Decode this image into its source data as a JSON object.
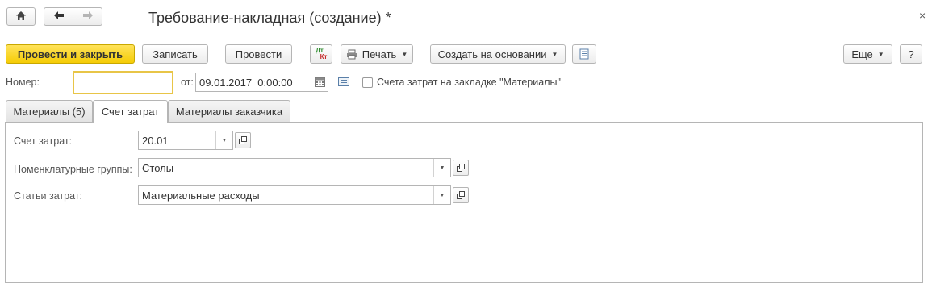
{
  "window": {
    "title": "Требование-накладная (создание) *",
    "close_glyph": "×"
  },
  "nav": {
    "home_icon": "home-icon",
    "back_icon": "arrow-left-icon",
    "forward_icon": "arrow-right-icon"
  },
  "toolbar": {
    "post_close_label": "Провести и закрыть",
    "save_label": "Записать",
    "post_label": "Провести",
    "dtkt_top": "Дт",
    "dtkt_bottom": "Кт",
    "print_label": "Печать",
    "create_based_label": "Создать на основании",
    "more_label": "Еще",
    "help_label": "?"
  },
  "header": {
    "number_label": "Номер:",
    "number_value": "",
    "date_label": "от:",
    "date_value": "09.01.2017  0:00:00",
    "checkbox_label": "Счета затрат на закладке \"Материалы\"",
    "checkbox_checked": false
  },
  "tabs": [
    {
      "label": "Материалы (5)",
      "active": false
    },
    {
      "label": "Счет затрат",
      "active": true
    },
    {
      "label": "Материалы заказчика",
      "active": false
    }
  ],
  "form": {
    "cost_account_label": "Счет затрат:",
    "cost_account_value": "20.01",
    "nomenclature_label": "Номенклатурные группы:",
    "nomenclature_value": "Столы",
    "cost_items_label": "Статьи затрат:",
    "cost_items_value": "Материальные расходы"
  },
  "colors": {
    "primary_button": "#f5cc06",
    "number_field_focus": "#e8c547",
    "dtkt_green": "#2e8b2e",
    "dtkt_red": "#c62828"
  }
}
